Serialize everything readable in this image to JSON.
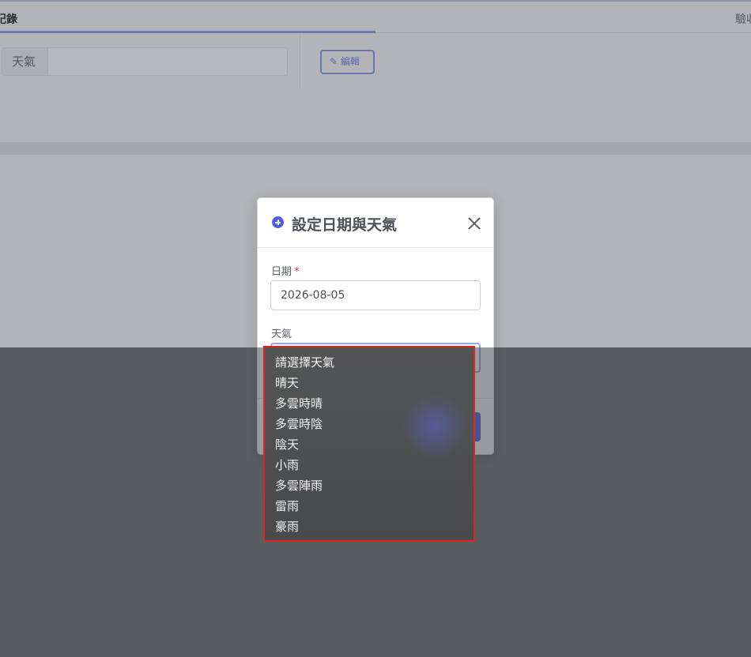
{
  "background": {
    "page_title": "記錄",
    "page_title_right": "驗收",
    "field_label": "天氣",
    "edit_button_label": "編輯"
  },
  "modal": {
    "title": "設定日期與天氣",
    "date_label": "日期",
    "required_mark": "*",
    "date_value": "2026-08-05",
    "weather_label": "天氣"
  },
  "dropdown": {
    "options": [
      "請選擇天氣",
      "晴天",
      "多雲時晴",
      "多雲時陰",
      "陰天",
      "小雨",
      "多雲陣雨",
      "雷雨",
      "豪雨"
    ]
  },
  "colors": {
    "accent": "#4e5ce9",
    "highlight_border": "#e0231e"
  }
}
